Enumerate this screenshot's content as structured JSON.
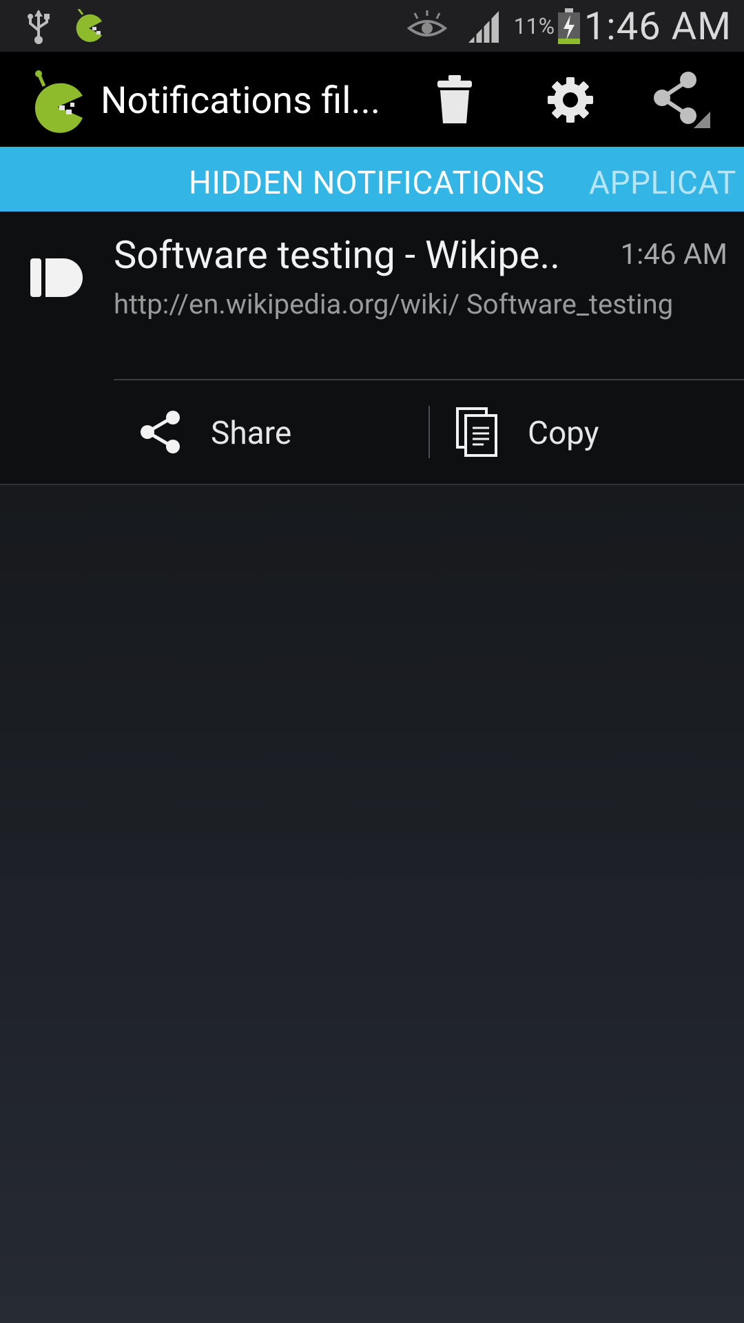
{
  "status_bar": {
    "icons": [
      "usb-icon",
      "app-notification-icon",
      "eye-icon",
      "signal-icon",
      "battery-charging-icon"
    ],
    "battery_percent": "11%",
    "time": "1:46 AM"
  },
  "action_bar": {
    "title": "Notifications fil...",
    "buttons": [
      "trash-icon",
      "gear-icon",
      "share-icon"
    ]
  },
  "tabs": [
    {
      "label": "HIDDEN NOTIFICATIONS",
      "selected": true
    },
    {
      "label": "APPLICAT",
      "selected": false
    }
  ],
  "notification": {
    "app_icon": "pushbullet-icon",
    "title": "Software testing - Wikipe..",
    "time": "1:46 AM",
    "url": "http://en.wikipedia.org/wiki/ Software_testing",
    "actions": [
      {
        "label": "Share",
        "icon": "share-icon"
      },
      {
        "label": "Copy",
        "icon": "copy-icon"
      }
    ]
  },
  "colors": {
    "tab_bar": "#33b5e5",
    "logo_green": "#8dbb2c",
    "action_bar": "#000000"
  }
}
